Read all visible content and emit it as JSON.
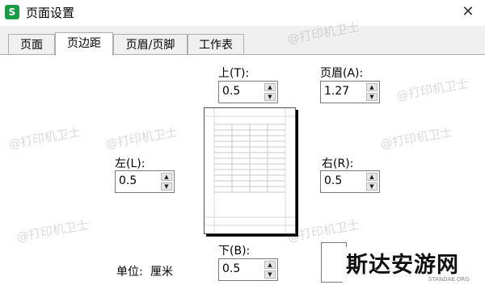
{
  "window": {
    "title": "页面设置",
    "app_icon_letter": "S",
    "close_glyph": "✕"
  },
  "tabs": [
    {
      "label": "页面",
      "active": false
    },
    {
      "label": "页边距",
      "active": true
    },
    {
      "label": "页眉/页脚",
      "active": false
    },
    {
      "label": "工作表",
      "active": false
    }
  ],
  "margins": {
    "top": {
      "label": "上(T):",
      "value": "0.5"
    },
    "header": {
      "label": "页眉(A):",
      "value": "1.27"
    },
    "left": {
      "label": "左(L):",
      "value": "0.5"
    },
    "right": {
      "label": "右(R):",
      "value": "0.5"
    },
    "bottom": {
      "label": "下(B):",
      "value": "0.5"
    }
  },
  "unit": {
    "label": "单位:",
    "value": "厘米"
  },
  "watermark_text": "@打印机卫士",
  "brand": {
    "name": "斯达安游网",
    "sub": "STANDAE.ORG"
  },
  "colors": {
    "app_icon": "#1a9c47"
  }
}
